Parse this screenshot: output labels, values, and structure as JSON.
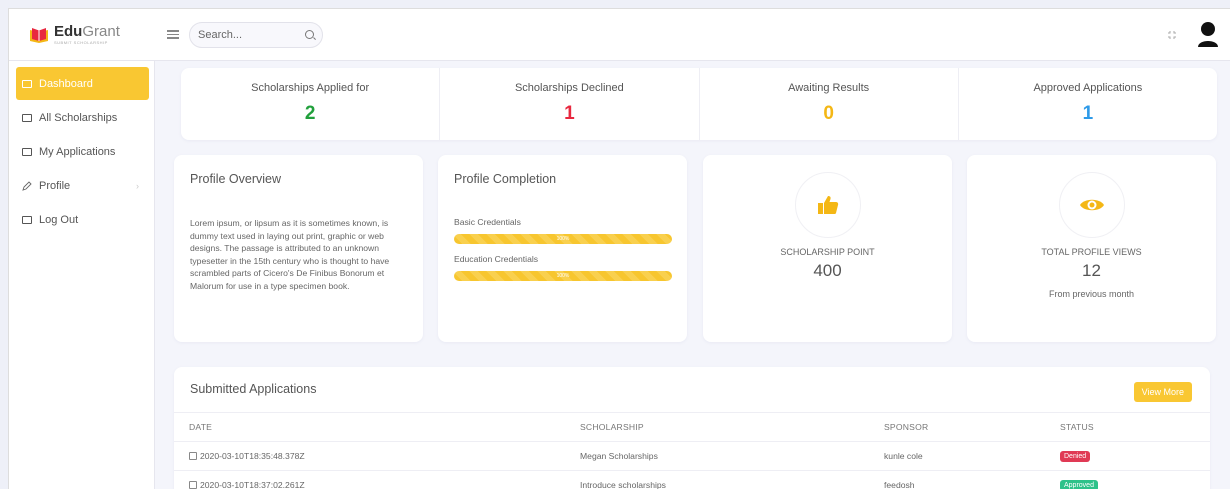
{
  "brand": {
    "name_bold": "Edu",
    "name_light": "Grant",
    "tagline": "SUBMIT SCHOLARSHIP"
  },
  "search": {
    "placeholder": "Search..."
  },
  "sidebar": {
    "items": [
      {
        "label": "Dashboard",
        "active": true
      },
      {
        "label": "All Scholarships"
      },
      {
        "label": "My Applications"
      },
      {
        "label": "Profile",
        "has_chevron": true
      },
      {
        "label": "Log Out"
      }
    ],
    "chevron": "›"
  },
  "stats": [
    {
      "label": "Scholarships Applied for",
      "value": "2",
      "color": "#21a03c"
    },
    {
      "label": "Scholarships Declined",
      "value": "1",
      "color": "#e8283f"
    },
    {
      "label": "Awaiting Results",
      "value": "0",
      "color": "#f4b715"
    },
    {
      "label": "Approved Applications",
      "value": "1",
      "color": "#2e9ae8"
    }
  ],
  "profile_overview": {
    "title": "Profile Overview",
    "text": "Lorem ipsum, or lipsum as it is sometimes known, is dummy text used in laying out print, graphic or web designs. The passage is attributed to an unknown typesetter in the 15th century who is thought to have scrambled parts of Cicero's De Finibus Bonorum et Malorum for use in a type specimen book."
  },
  "profile_completion": {
    "title": "Profile Completion",
    "items": [
      {
        "label": "Basic Credentials",
        "percent": 100,
        "text": "100%"
      },
      {
        "label": "Education Credentials",
        "percent": 100,
        "text": "100%"
      }
    ]
  },
  "scholarship_point": {
    "label": "SCHOLARSHIP POINT",
    "value": "400",
    "icon": "thumbs-up-icon"
  },
  "profile_views": {
    "label": "TOTAL PROFILE VIEWS",
    "value": "12",
    "note": "From previous month",
    "icon": "eye-icon"
  },
  "accent": "#f9c732",
  "applications": {
    "title": "Submitted Applications",
    "view_more": "View More",
    "columns": [
      "DATE",
      "SCHOLARSHIP",
      "SPONSOR",
      "STATUS"
    ],
    "rows": [
      {
        "date": "2020-03-10T18:35:48.378Z",
        "scholarship": "Megan Scholarships",
        "sponsor": "kunle cole",
        "status": "Denied",
        "status_color": "#e03a55"
      },
      {
        "date": "2020-03-10T18:37:02.261Z",
        "scholarship": "Introduce scholarships",
        "sponsor": "feedosh",
        "status": "Approved",
        "status_color": "#2ec28a"
      }
    ]
  }
}
